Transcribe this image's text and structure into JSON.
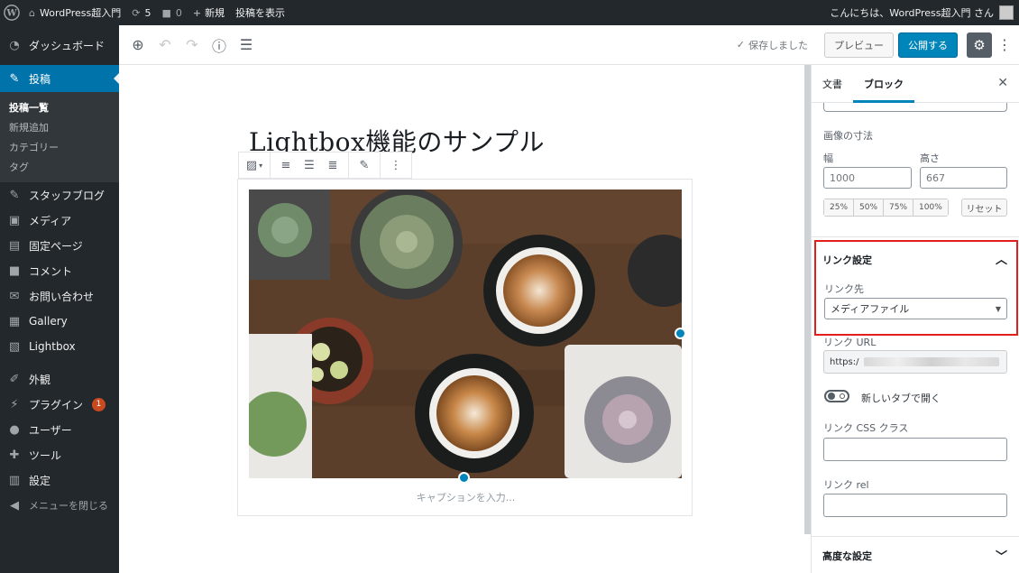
{
  "adminbar": {
    "site_name": "WordPress超入門",
    "updates_count": "5",
    "comments_count": "0",
    "new_label": "新規",
    "view_post_label": "投稿を表示",
    "greeting": "こんにちは、WordPress超入門 さん"
  },
  "sidebar": {
    "dashboard": "ダッシュボード",
    "posts": "投稿",
    "posts_sub": [
      "投稿一覧",
      "新規追加",
      "カテゴリー",
      "タグ"
    ],
    "staff_blog": "スタッフブログ",
    "media": "メディア",
    "pages": "固定ページ",
    "comments": "コメント",
    "contact": "お問い合わせ",
    "gallery": "Gallery",
    "lightbox": "Lightbox",
    "appearance": "外観",
    "plugins": "プラグイン",
    "plugins_badge": "1",
    "users": "ユーザー",
    "tools": "ツール",
    "settings": "設定",
    "collapse": "メニューを閉じる"
  },
  "editor_top": {
    "saved_label": "保存しました",
    "preview_label": "プレビュー",
    "publish_label": "公開する"
  },
  "post": {
    "title": "Lightbox機能のサンプル",
    "caption_placeholder": "キャプションを入力..."
  },
  "panel": {
    "tab_document": "文書",
    "tab_block": "ブロック",
    "image_size_label": "画像の寸法",
    "width_label": "幅",
    "height_label": "高さ",
    "width_value": "1000",
    "height_value": "667",
    "percent_buttons": [
      "25%",
      "50%",
      "75%",
      "100%"
    ],
    "reset_label": "リセット",
    "link_settings_title": "リンク設定",
    "link_to_label": "リンク先",
    "link_to_value": "メディアファイル",
    "link_url_label": "リンク URL",
    "link_url_value": "https:/",
    "new_tab_label": "新しいタブで開く",
    "css_class_label": "リンク CSS クラス",
    "rel_label": "リンク rel",
    "advanced_title": "高度な設定"
  },
  "colors": {
    "admin_dark": "#23282d",
    "accent_blue": "#0073aa",
    "publish_blue": "#0085ba",
    "highlight_red": "#e0201a"
  }
}
